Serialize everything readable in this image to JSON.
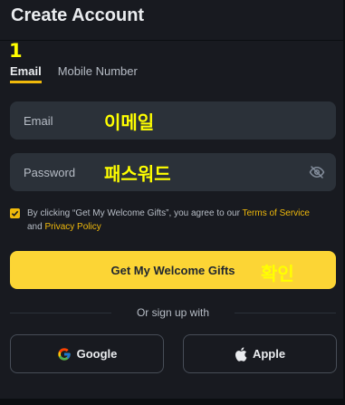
{
  "page": {
    "title": "Create Account"
  },
  "annotations": {
    "step": "1",
    "email_label": "이메일",
    "password_label": "패스워드",
    "confirm_label": "확인"
  },
  "tabs": [
    {
      "label": "Email",
      "active": true
    },
    {
      "label": "Mobile Number",
      "active": false
    }
  ],
  "form": {
    "email_placeholder": "Email",
    "password_placeholder": "Password",
    "password_toggle_icon": "eye-off-icon"
  },
  "terms": {
    "checked": true,
    "prefix": "By clicking “Get My Welcome Gifts”, you agree to our ",
    "terms_link": "Terms of Service",
    "and": " and ",
    "privacy_link": "Privacy Policy"
  },
  "primary_button": {
    "label": "Get My Welcome Gifts"
  },
  "divider": {
    "text": "Or sign up with"
  },
  "social": {
    "google_label": "Google",
    "apple_label": "Apple"
  },
  "colors": {
    "background": "#181a20",
    "accent": "#fcd535",
    "link": "#f0b90b",
    "field_bg": "#2b3139",
    "annotation": "#ffff00"
  }
}
